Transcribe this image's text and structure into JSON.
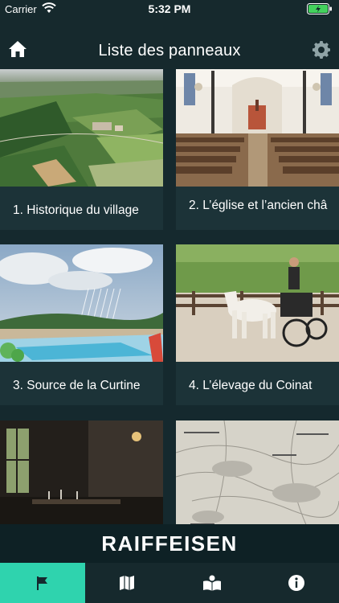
{
  "status": {
    "carrier": "Carrier",
    "time": "5:32 PM"
  },
  "nav": {
    "title": "Liste des panneaux",
    "left_icon": "home-icon",
    "right_icon": "gear-icon"
  },
  "tiles": [
    {
      "label": "1. Historique du village",
      "image": "aerial-village-fields"
    },
    {
      "label": "2. L’église et l’ancien châ",
      "image": "church-interior"
    },
    {
      "label": "3. Source de la Curtine",
      "image": "water-cycle-diagram"
    },
    {
      "label": "4. L’élevage du Coinat",
      "image": "horse-carriage"
    },
    {
      "label": "",
      "image": "dark-restaurant-interior"
    },
    {
      "label": "",
      "image": "old-map"
    }
  ],
  "brand": {
    "text": "RAIFFEISEN"
  },
  "tabs": [
    {
      "icon": "flag-icon",
      "active": true
    },
    {
      "icon": "map-icon",
      "active": false
    },
    {
      "icon": "book-icon",
      "active": false
    },
    {
      "icon": "info-icon",
      "active": false
    }
  ],
  "colors": {
    "background": "#15292e",
    "accent": "#2fd3ae",
    "tile": "#1c3338"
  }
}
